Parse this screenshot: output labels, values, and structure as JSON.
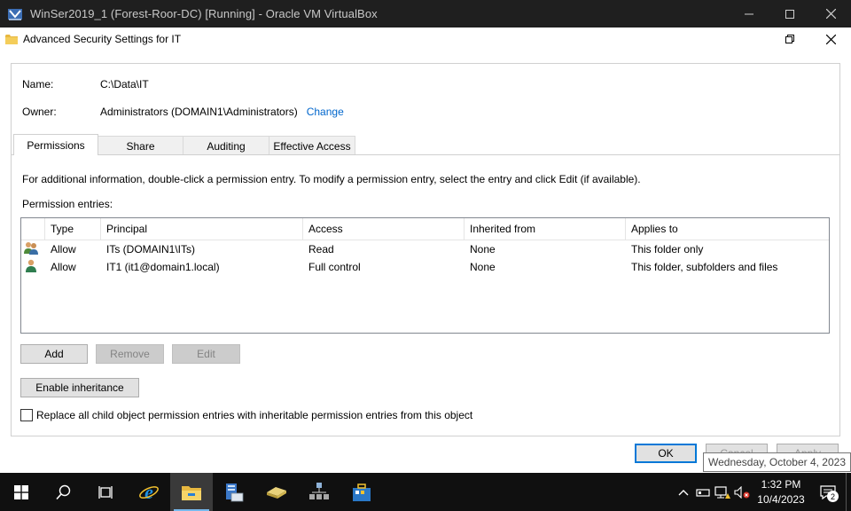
{
  "vbox": {
    "title": "WinSer2019_1 (Forest-Roor-DC) [Running] - Oracle VM VirtualBox",
    "logo_icon": "virtualbox-logo-icon"
  },
  "dialog": {
    "title": "Advanced Security Settings for IT",
    "name_label": "Name:",
    "name_value": "C:\\Data\\IT",
    "owner_label": "Owner:",
    "owner_value": "Administrators (DOMAIN1\\Administrators)",
    "change_link": "Change",
    "tabs": [
      {
        "label": "Permissions",
        "active": true
      },
      {
        "label": "Share",
        "active": false
      },
      {
        "label": "Auditing",
        "active": false
      },
      {
        "label": "Effective Access",
        "active": false
      }
    ],
    "info_text": "For additional information, double-click a permission entry. To modify a permission entry, select the entry and click Edit (if available).",
    "entries_label": "Permission entries:",
    "columns": [
      "Type",
      "Principal",
      "Access",
      "Inherited from",
      "Applies to"
    ],
    "entries": [
      {
        "icon": "group-icon",
        "type": "Allow",
        "principal": "ITs (DOMAIN1\\ITs)",
        "access": "Read",
        "inherited": "None",
        "applies": "This folder only"
      },
      {
        "icon": "user-icon",
        "type": "Allow",
        "principal": "IT1 (it1@domain1.local)",
        "access": "Full control",
        "inherited": "None",
        "applies": "This folder, subfolders and files"
      }
    ],
    "add_button": "Add",
    "remove_button": "Remove",
    "edit_button": "Edit",
    "enable_inheritance_button": "Enable inheritance",
    "replace_checkbox_label": "Replace all child object permission entries with inheritable permission entries from this object",
    "replace_checked": false,
    "ok_button": "OK",
    "cancel_button": "Cancel",
    "apply_button": "Apply"
  },
  "tooltip": "Wednesday, October 4, 2023",
  "taskbar": {
    "items": [
      {
        "name": "start-button",
        "icon": "windows-logo-icon"
      },
      {
        "name": "search-button",
        "icon": "search-icon"
      },
      {
        "name": "task-view-button",
        "icon": "task-view-icon"
      },
      {
        "name": "internet-explorer-button",
        "icon": "internet-explorer-icon"
      },
      {
        "name": "file-explorer-button",
        "icon": "file-explorer-icon",
        "active": true
      },
      {
        "name": "server-manager-button",
        "icon": "server-manager-icon"
      },
      {
        "name": "active-directory-button",
        "icon": "ad-users-computers-icon"
      },
      {
        "name": "network-button",
        "icon": "network-icon"
      },
      {
        "name": "toolbox-button",
        "icon": "toolbox-icon"
      }
    ],
    "clock_time": "1:32 PM",
    "clock_date": "10/4/2023",
    "notification_count": "2"
  },
  "colors": {
    "link": "#0066cc",
    "accent": "#0078d7",
    "taskbar": "#101010",
    "host_titlebar": "#1f1f1f"
  }
}
